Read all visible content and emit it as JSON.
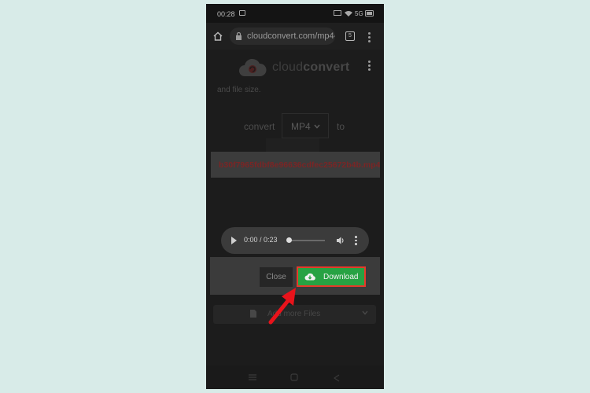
{
  "status_bar": {
    "time": "00:28",
    "network": "5G"
  },
  "browser": {
    "url": "cloudconvert.com/mp4-",
    "tab_count": "5"
  },
  "brand": {
    "name_light": "cloud",
    "name_bold": "convert"
  },
  "page": {
    "description_fragment": "and file size.",
    "convert_label": "convert",
    "format_value": "MP4",
    "to_label": "to"
  },
  "file": {
    "name": "b30f7965fdbf8e96636cdfec25672b4b.mp4"
  },
  "audio_player": {
    "time": "0:00 / 0:23",
    "progress": 0.0
  },
  "modal": {
    "close_label": "Close",
    "download_label": "Download"
  },
  "add_more": {
    "label": "Add more Files"
  },
  "colors": {
    "accent_green": "#27a243",
    "highlight_red": "#e53a2a",
    "arrow_red": "#e8131b"
  },
  "icons": [
    "home-icon",
    "lock-icon",
    "tabs-icon",
    "more-icon",
    "cloud-logo-icon",
    "chevron-down-icon",
    "play-icon",
    "volume-icon",
    "cloud-download-icon",
    "file-icon",
    "nav-menu-icon",
    "nav-home-icon",
    "nav-back-icon"
  ]
}
